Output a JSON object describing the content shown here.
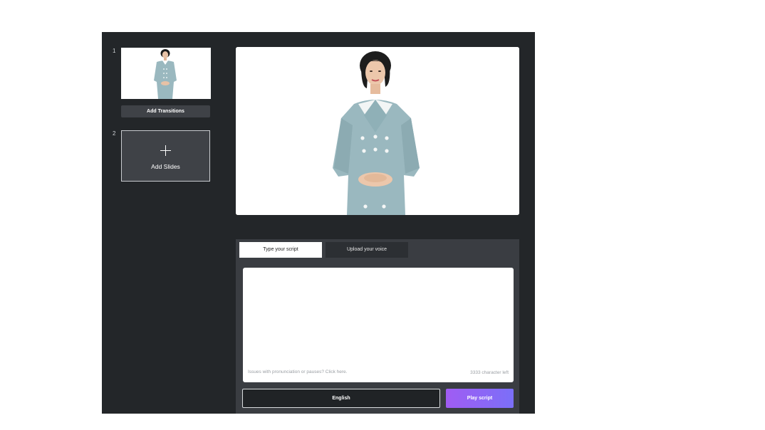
{
  "slides": [
    {
      "number": "1",
      "transitions_label": "Add Transitions"
    },
    {
      "number": "2",
      "add_label": "Add Slides"
    }
  ],
  "script_panel": {
    "tabs": [
      {
        "label": "Type your script",
        "active": true
      },
      {
        "label": "Upload your voice",
        "active": false
      }
    ],
    "script_value": "",
    "hint_text": "Issues with pronunciation or pauses? Click here.",
    "chars_left": "3333 character left",
    "language": "English",
    "play_label": "Play script"
  },
  "colors": {
    "app_background": "#232629",
    "panel": "#3a3d42",
    "button_dark": "#3f4247",
    "accent_gradient_start": "#a05cf3",
    "accent_gradient_end": "#7b6ff8",
    "avatar_dress": "#9ab8bf"
  },
  "icons": {
    "add_slide": "plus-icon"
  }
}
